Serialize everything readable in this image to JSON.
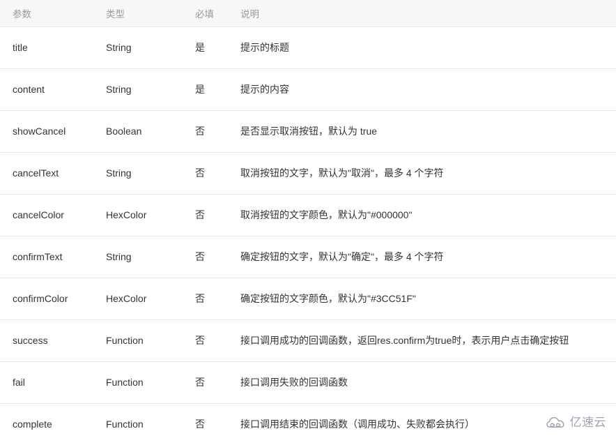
{
  "table": {
    "columns": [
      {
        "key": "name",
        "label": "参数"
      },
      {
        "key": "type",
        "label": "类型"
      },
      {
        "key": "required",
        "label": "必填"
      },
      {
        "key": "description",
        "label": "说明"
      }
    ],
    "rows": [
      {
        "name": "title",
        "type": "String",
        "required": "是",
        "description": "提示的标题"
      },
      {
        "name": "content",
        "type": "String",
        "required": "是",
        "description": "提示的内容"
      },
      {
        "name": "showCancel",
        "type": "Boolean",
        "required": "否",
        "description": "是否显示取消按钮，默认为 true"
      },
      {
        "name": "cancelText",
        "type": "String",
        "required": "否",
        "description": "取消按钮的文字，默认为\"取消\"，最多 4 个字符"
      },
      {
        "name": "cancelColor",
        "type": "HexColor",
        "required": "否",
        "description": "取消按钮的文字颜色，默认为\"#000000\""
      },
      {
        "name": "confirmText",
        "type": "String",
        "required": "否",
        "description": "确定按钮的文字，默认为\"确定\"，最多 4 个字符"
      },
      {
        "name": "confirmColor",
        "type": "HexColor",
        "required": "否",
        "description": "确定按钮的文字颜色，默认为\"#3CC51F\""
      },
      {
        "name": "success",
        "type": "Function",
        "required": "否",
        "description": "接口调用成功的回调函数，返回res.confirm为true时，表示用户点击确定按钮"
      },
      {
        "name": "fail",
        "type": "Function",
        "required": "否",
        "description": "接口调用失败的回调函数"
      },
      {
        "name": "complete",
        "type": "Function",
        "required": "否",
        "description": "接口调用结束的回调函数（调用成功、失败都会执行）"
      }
    ]
  },
  "watermark": {
    "icon": "cloud-icon",
    "text": "亿速云",
    "color": "#9aa0ae"
  },
  "colors": {
    "header_background": "#f7f7f8",
    "header_text": "#9b9b9b",
    "body_text": "#2f3437",
    "row_divider": "#e6e6e6",
    "page_background": "#ffffff"
  }
}
